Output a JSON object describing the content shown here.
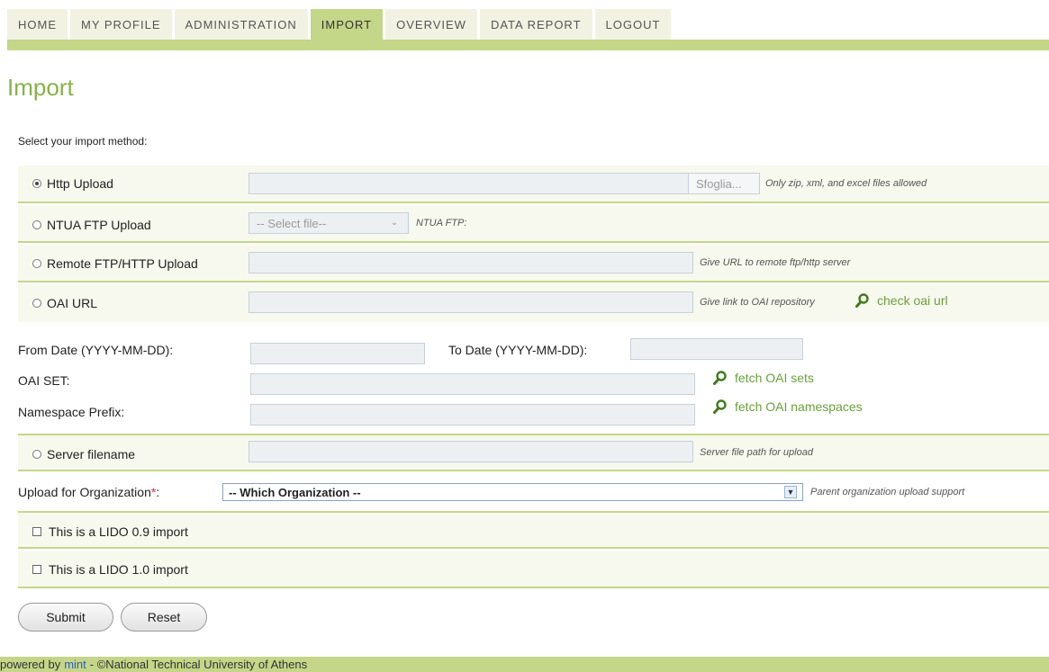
{
  "nav": {
    "tabs": [
      {
        "label": "HOME",
        "active": false
      },
      {
        "label": "MY PROFILE",
        "active": false
      },
      {
        "label": "ADMINISTRATION",
        "active": false
      },
      {
        "label": "IMPORT",
        "active": true
      },
      {
        "label": "OVERVIEW",
        "active": false
      },
      {
        "label": "DATA REPORT",
        "active": false
      },
      {
        "label": "LOGOUT",
        "active": false
      }
    ]
  },
  "page": {
    "title": "Import",
    "intro": "Select your import method:"
  },
  "http_upload": {
    "label": "Http Upload",
    "browse_label": "Sfoglia...",
    "hint": "Only zip, xml, and excel files allowed"
  },
  "ntua_ftp": {
    "label": "NTUA FTP Upload",
    "select_value": "-- Select file--",
    "hint": "NTUA FTP:"
  },
  "remote_ftp": {
    "label": "Remote FTP/HTTP Upload",
    "hint": "Give URL to remote ftp/http server"
  },
  "oai_url": {
    "label": "OAI URL",
    "hint": "Give link to OAI repository",
    "check_link": "check oai url"
  },
  "oai_details": {
    "from_label": "From Date (YYYY-MM-DD):",
    "to_label": "To Date (YYYY-MM-DD):",
    "set_label": "OAI SET:",
    "prefix_label": "Namespace Prefix:",
    "fetch_sets": "fetch OAI sets",
    "fetch_namespaces": "fetch OAI namespaces"
  },
  "server_filename": {
    "label": "Server filename",
    "hint": "Server file path for upload"
  },
  "organization": {
    "label": "Upload for Organization",
    "required_mark": "*",
    "colon": ":",
    "selected": "-- Which Organization --",
    "hint": "Parent organization upload support"
  },
  "lido09": {
    "label": "This is a LIDO 0.9 import"
  },
  "lido10": {
    "label": "This is a LIDO 1.0 import"
  },
  "buttons": {
    "submit": "Submit",
    "reset": "Reset"
  },
  "footer": {
    "prefix": "powered by",
    "link": "mint",
    "suffix": "- ©National Technical University of Athens"
  }
}
